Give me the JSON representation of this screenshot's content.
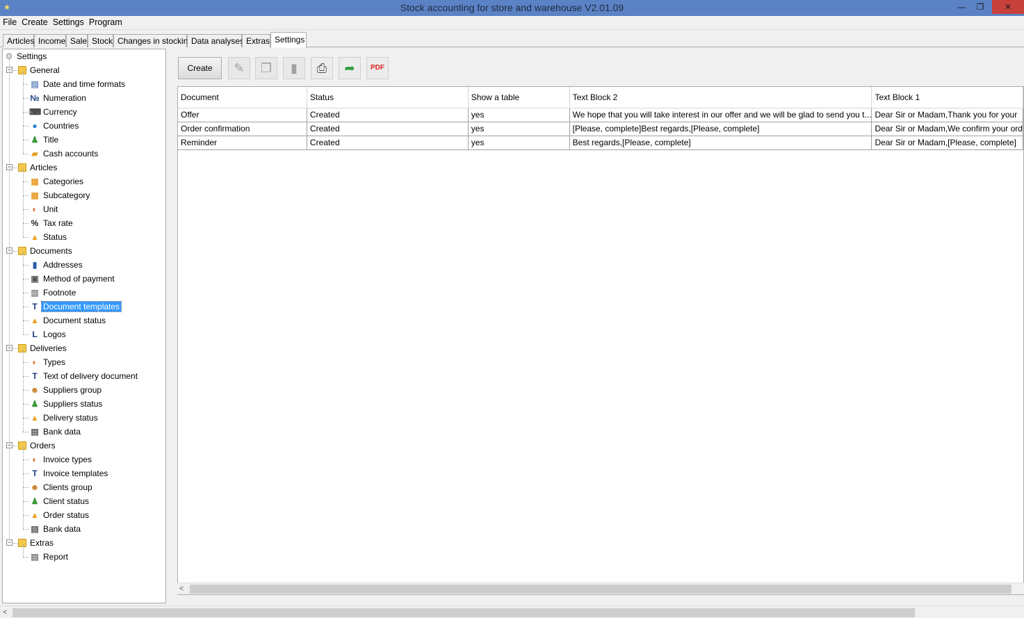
{
  "window": {
    "title": "Stock accounting for store and warehouse V2.01.09",
    "minimize_glyph": "—",
    "maximize_glyph": "❐",
    "close_glyph": "✕"
  },
  "menu": [
    "File",
    "Create",
    "Settings",
    "Program"
  ],
  "tabs": [
    {
      "label": "Articles",
      "active": false
    },
    {
      "label": "Income",
      "active": false
    },
    {
      "label": "Sale",
      "active": false
    },
    {
      "label": "Stock",
      "active": false
    },
    {
      "label": "Changes in stocking",
      "active": false
    },
    {
      "label": "Data analyses",
      "active": false
    },
    {
      "label": "Extras",
      "active": false
    },
    {
      "label": "Settings",
      "active": true
    }
  ],
  "tree": {
    "root": {
      "label": "Settings",
      "icon": "gear-icon"
    },
    "groups": [
      {
        "label": "General",
        "items": [
          {
            "label": "Date and time formats",
            "icon": "calendar-icon"
          },
          {
            "label": "Numeration",
            "icon": "numero-icon"
          },
          {
            "label": "Currency",
            "icon": "cash-register-icon"
          },
          {
            "label": "Countries",
            "icon": "globe-icon"
          },
          {
            "label": "Title",
            "icon": "person-icon"
          },
          {
            "label": "Cash accounts",
            "icon": "money-icon"
          }
        ]
      },
      {
        "label": "Articles",
        "items": [
          {
            "label": "Categories",
            "icon": "categories-icon"
          },
          {
            "label": "Subcategory",
            "icon": "subcategory-icon"
          },
          {
            "label": "Unit",
            "icon": "unit-icon"
          },
          {
            "label": "Tax rate",
            "icon": "percent-icon"
          },
          {
            "label": "Status",
            "icon": "warning-icon"
          }
        ]
      },
      {
        "label": "Documents",
        "items": [
          {
            "label": "Addresses",
            "icon": "address-book-icon"
          },
          {
            "label": "Method of payment",
            "icon": "payment-icon"
          },
          {
            "label": "Footnote",
            "icon": "footnote-icon"
          },
          {
            "label": "Document templates",
            "icon": "text-template-icon",
            "selected": true
          },
          {
            "label": "Document status",
            "icon": "warning-icon"
          },
          {
            "label": "Logos",
            "icon": "logo-icon"
          }
        ]
      },
      {
        "label": "Deliveries",
        "items": [
          {
            "label": "Types",
            "icon": "types-icon"
          },
          {
            "label": "Text of delivery document",
            "icon": "text-template-icon"
          },
          {
            "label": "Suppliers group",
            "icon": "group-icon"
          },
          {
            "label": "Suppliers status",
            "icon": "person-icon"
          },
          {
            "label": "Delivery status",
            "icon": "warning-icon"
          },
          {
            "label": "Bank data",
            "icon": "bank-icon"
          }
        ]
      },
      {
        "label": "Orders",
        "items": [
          {
            "label": "Invoice types",
            "icon": "types-icon"
          },
          {
            "label": "Invoice templates",
            "icon": "text-template-icon"
          },
          {
            "label": "Clients group",
            "icon": "group-icon"
          },
          {
            "label": "Client status",
            "icon": "person-icon"
          },
          {
            "label": "Order status",
            "icon": "warning-icon"
          },
          {
            "label": "Bank data",
            "icon": "bank-icon"
          }
        ]
      },
      {
        "label": "Extras",
        "items": [
          {
            "label": "Report",
            "icon": "report-icon"
          }
        ]
      }
    ]
  },
  "toolbar": {
    "create_label": "Create",
    "buttons": [
      {
        "name": "edit-button",
        "icon": "pencil-icon",
        "enabled": false
      },
      {
        "name": "copy-button",
        "icon": "copy-icon",
        "enabled": false
      },
      {
        "name": "delete-button",
        "icon": "trash-icon",
        "enabled": false
      },
      {
        "name": "print-button",
        "icon": "printer-icon",
        "enabled": true
      },
      {
        "name": "export-button",
        "icon": "export-icon",
        "enabled": true
      },
      {
        "name": "pdf-button",
        "icon": "pdf-icon",
        "enabled": true
      }
    ]
  },
  "grid": {
    "columns": [
      "Document",
      "Status",
      "Show a table",
      "Text Block 2",
      "Text Block 1"
    ],
    "rows": [
      [
        "Offer",
        "Created",
        "yes",
        "We hope that you will take interest in our offer and we will be glad to send you t...",
        "Dear Sir or Madam,Thank you for your"
      ],
      [
        "Order confirmation",
        "Created",
        "yes",
        "[Please, complete]Best regards,[Please, complete]",
        "Dear Sir or Madam,We confirm your ord"
      ],
      [
        "Reminder",
        "Created",
        "yes",
        "Best regards,[Please, complete]",
        "Dear Sir or Madam,[Please, complete]"
      ]
    ]
  },
  "colors": {
    "titlebar": "#5b82c4",
    "close_button": "#c7413a",
    "selection": "#3399ff"
  }
}
